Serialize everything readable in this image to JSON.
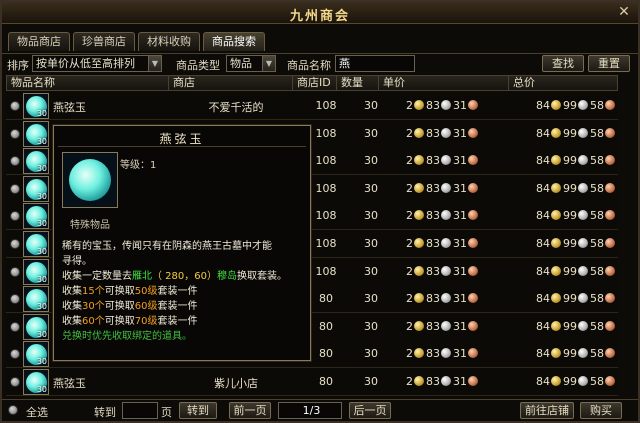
{
  "window": {
    "title": "九州商会",
    "close_symbol": "✕"
  },
  "tabs": [
    {
      "label": "物品商店"
    },
    {
      "label": "珍兽商店"
    },
    {
      "label": "材料收购"
    },
    {
      "label": "商品搜索",
      "active": true
    }
  ],
  "filters": {
    "sort_label": "排序",
    "sort_value": "按单价从低至高排列",
    "type_label": "商品类型",
    "type_value": "物品",
    "name_label": "商品名称",
    "name_value": "燕",
    "search_button": "查找",
    "reset_button": "重置"
  },
  "columns": [
    "物品名称",
    "商店",
    "商店ID",
    "数量",
    "单价",
    "总价"
  ],
  "rows": [
    {
      "name": "燕弦玉",
      "shop": "不爱千活的",
      "shop_id": "108",
      "qty": "30",
      "unit": [
        "2",
        "83",
        "31"
      ],
      "total": [
        "84",
        "99",
        "58"
      ],
      "count": "30"
    },
    {
      "name": "",
      "shop": "",
      "shop_id": "108",
      "qty": "30",
      "unit": [
        "2",
        "83",
        "31"
      ],
      "total": [
        "84",
        "99",
        "58"
      ],
      "count": "30"
    },
    {
      "name": "",
      "shop": "",
      "shop_id": "108",
      "qty": "30",
      "unit": [
        "2",
        "83",
        "31"
      ],
      "total": [
        "84",
        "99",
        "58"
      ],
      "count": "30"
    },
    {
      "name": "",
      "shop": "",
      "shop_id": "108",
      "qty": "30",
      "unit": [
        "2",
        "83",
        "31"
      ],
      "total": [
        "84",
        "99",
        "58"
      ],
      "count": "30"
    },
    {
      "name": "",
      "shop": "",
      "shop_id": "108",
      "qty": "30",
      "unit": [
        "2",
        "83",
        "31"
      ],
      "total": [
        "84",
        "99",
        "58"
      ],
      "count": "30"
    },
    {
      "name": "",
      "shop": "",
      "shop_id": "108",
      "qty": "30",
      "unit": [
        "2",
        "83",
        "31"
      ],
      "total": [
        "84",
        "99",
        "58"
      ],
      "count": "30"
    },
    {
      "name": "",
      "shop": "",
      "shop_id": "108",
      "qty": "30",
      "unit": [
        "2",
        "83",
        "31"
      ],
      "total": [
        "84",
        "99",
        "58"
      ],
      "count": "30"
    },
    {
      "name": "",
      "shop": "",
      "shop_id": "80",
      "qty": "30",
      "unit": [
        "2",
        "83",
        "31"
      ],
      "total": [
        "84",
        "99",
        "58"
      ],
      "count": "30"
    },
    {
      "name": "",
      "shop": "",
      "shop_id": "80",
      "qty": "30",
      "unit": [
        "2",
        "83",
        "31"
      ],
      "total": [
        "84",
        "99",
        "58"
      ],
      "count": "30"
    },
    {
      "name": "",
      "shop": "",
      "shop_id": "80",
      "qty": "30",
      "unit": [
        "2",
        "83",
        "31"
      ],
      "total": [
        "84",
        "99",
        "58"
      ],
      "count": "30"
    },
    {
      "name": "燕弦玉",
      "shop": "紫儿小店",
      "shop_id": "80",
      "qty": "30",
      "unit": [
        "2",
        "83",
        "31"
      ],
      "total": [
        "84",
        "99",
        "58"
      ],
      "count": "30"
    }
  ],
  "tooltip": {
    "title": "燕弦玉",
    "level": "等级：1",
    "category": "特殊物品",
    "desc_line1": "稀有的宝玉，传闻只有在阴森的燕王古墓中才能",
    "desc_line2": "寻得。",
    "collect_pre": "收集一定数量去",
    "collect_loc": "雁北",
    "collect_coords": "（ 280，60）",
    "collect_npc": "穆岛",
    "collect_post": "换取套装。",
    "t1_a": "收集",
    "t1_n": "15个",
    "t1_b": "可换取",
    "t1_lv": "50级",
    "t1_c": "套装一件",
    "t2_a": "收集",
    "t2_n": "30个",
    "t2_b": "可换取",
    "t2_lv": "60级",
    "t2_c": "套装一件",
    "t3_a": "收集",
    "t3_n": "60个",
    "t3_b": "可换取",
    "t3_lv": "70级",
    "t3_c": "套装一件",
    "note": "兑换时优先收取绑定的道具。"
  },
  "footer": {
    "select_all": "全选",
    "goto_label": "转到",
    "page_unit": "页",
    "goto_button": "转到",
    "prev_button": "前一页",
    "page_indicator": "1/3",
    "next_button": "后一页",
    "visit_shop_button": "前往店铺",
    "buy_button": "购买"
  }
}
